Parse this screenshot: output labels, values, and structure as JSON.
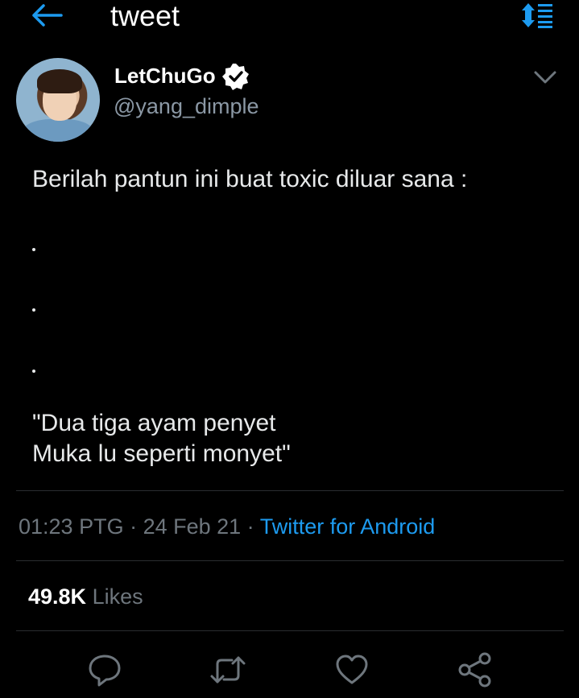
{
  "header": {
    "title": "tweet",
    "back_icon": "arrow-left-icon",
    "sort_icon": "sort-list-icon"
  },
  "author": {
    "display_name": "LetChuGo",
    "handle": "@yang_dimple",
    "verified": true
  },
  "tweet": {
    "lines": [
      "Berilah pantun ini buat toxic diluar sana :",
      "\"Dua tiga ayam penyet",
      "Muka lu seperti monyet\""
    ]
  },
  "meta": {
    "time": "01:23 PTG",
    "separator": " · ",
    "date": "24 Feb 21",
    "source": "Twitter for Android"
  },
  "stats": {
    "likes_count": "49.8K",
    "likes_label": "Likes"
  },
  "actions": [
    "reply-icon",
    "retweet-icon",
    "like-icon",
    "share-icon"
  ],
  "colors": {
    "background": "#000000",
    "accent": "#1d9bf0",
    "secondary_text": "#6e767d",
    "handle_text": "#8b98a5"
  }
}
